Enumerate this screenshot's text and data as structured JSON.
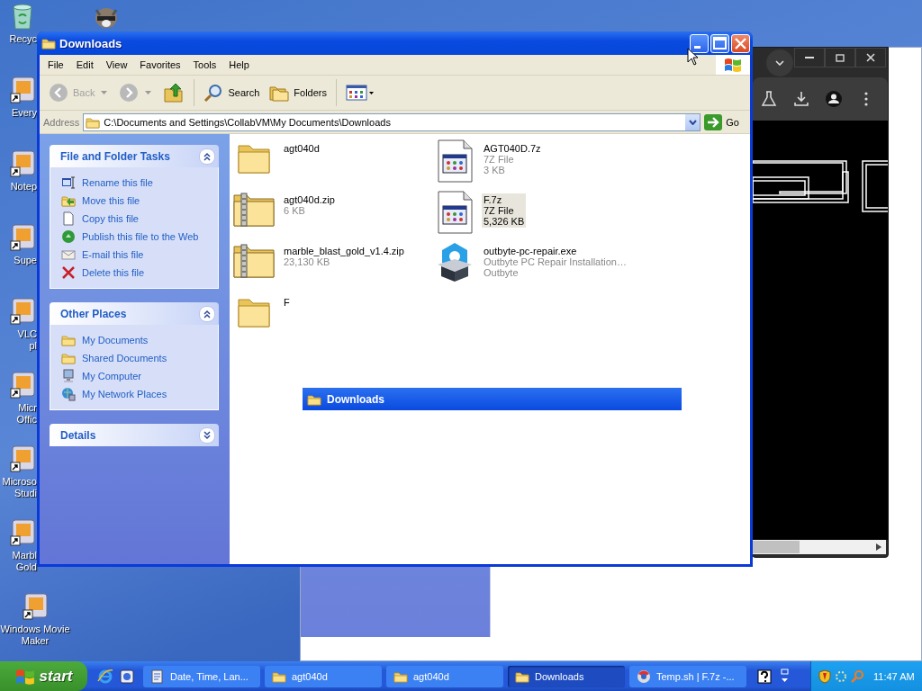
{
  "desktop": {
    "shortcuts_behind_window": [
      {
        "kind": "recycle-bin",
        "lines": [
          "Recyc"
        ]
      },
      {
        "kind": "shortcut",
        "lines": [
          "Every"
        ]
      },
      {
        "kind": "shortcut",
        "lines": [
          "Notep"
        ]
      },
      {
        "kind": "shortcut",
        "lines": [
          "Supe"
        ]
      },
      {
        "kind": "shortcut",
        "lines": [
          "VLC",
          "pl"
        ]
      },
      {
        "kind": "shortcut",
        "lines": [
          "Micr",
          "Offic"
        ]
      },
      {
        "kind": "shortcut",
        "lines": [
          "Microso",
          "Studi"
        ]
      },
      {
        "kind": "shortcut",
        "lines": [
          "Marbl",
          "Gold"
        ]
      }
    ],
    "shortcuts": [
      {
        "kind": "shortcut",
        "lines": [
          "Windows Movie",
          "Maker"
        ]
      }
    ]
  },
  "explorer": {
    "title": "Downloads",
    "menu": [
      "File",
      "Edit",
      "View",
      "Favorites",
      "Tools",
      "Help"
    ],
    "toolbar": {
      "back": {
        "label": "Back",
        "disabled": true
      },
      "forward": {
        "disabled": true
      },
      "search": "Search",
      "folders": "Folders"
    },
    "address": {
      "label": "Address",
      "value": "C:\\Documents and Settings\\CollabVM\\My Documents\\Downloads",
      "go": "Go"
    },
    "panels": [
      {
        "title": "File and Folder Tasks",
        "expanded": true,
        "items": [
          {
            "kind": "rename",
            "label": "Rename this file"
          },
          {
            "kind": "move",
            "label": "Move this file"
          },
          {
            "kind": "copy",
            "label": "Copy this file"
          },
          {
            "kind": "publish",
            "label": "Publish this file to the Web"
          },
          {
            "kind": "email",
            "label": "E-mail this file"
          },
          {
            "kind": "delete",
            "label": "Delete this file"
          }
        ]
      },
      {
        "title": "Other Places",
        "expanded": true,
        "items": [
          {
            "kind": "folder",
            "label": "My Documents"
          },
          {
            "kind": "folder",
            "label": "Shared Documents"
          },
          {
            "kind": "computer",
            "label": "My Computer"
          },
          {
            "kind": "network",
            "label": "My Network Places"
          }
        ]
      },
      {
        "title": "Details",
        "expanded": false
      }
    ],
    "files": [
      {
        "kind": "folder",
        "name": "agt040d",
        "selected": false
      },
      {
        "kind": "archive",
        "name": "AGT040D.7z",
        "details": [
          "7Z File",
          "3 KB"
        ],
        "selected": false
      },
      {
        "kind": "zipfolder",
        "name": "agt040d.zip",
        "details": [
          "6 KB"
        ],
        "selected": false
      },
      {
        "kind": "archive",
        "name": "F.7z",
        "details": [
          "7Z File",
          "5,326 KB"
        ],
        "selected": true
      },
      {
        "kind": "zipfolder",
        "name": "marble_blast_gold_v1.4.zip",
        "details": [
          "23,130 KB"
        ],
        "selected": false
      },
      {
        "kind": "installer",
        "name": "outbyte-pc-repair.exe",
        "details": [
          "Outbyte PC Repair Installation…",
          "Outbyte"
        ],
        "selected": false
      },
      {
        "kind": "folder",
        "name": "F",
        "selected": false
      }
    ]
  },
  "drag_outline": {
    "title": "Downloads"
  },
  "taskbar": {
    "start": "start",
    "tasks": [
      {
        "kind": "settings",
        "label": "Date, Time, Lan...",
        "selected": false
      },
      {
        "kind": "folder",
        "label": "agt040d",
        "selected": false
      },
      {
        "kind": "folder",
        "label": "agt040d",
        "selected": false
      },
      {
        "kind": "folder",
        "label": "Downloads",
        "selected": true
      },
      {
        "kind": "browser",
        "label": "Temp.sh | F.7z -...",
        "selected": false
      }
    ],
    "clock": "11:47 AM"
  }
}
